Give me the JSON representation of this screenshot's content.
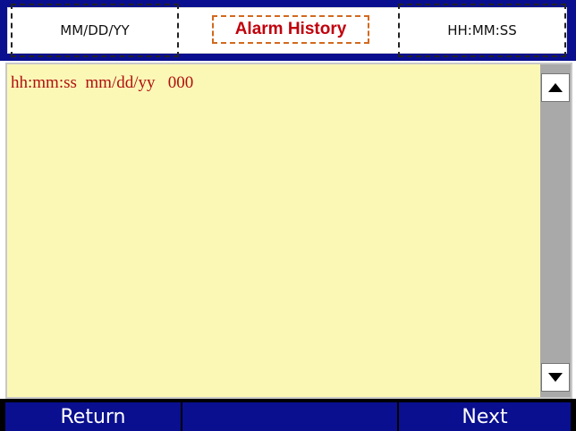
{
  "header": {
    "date_format": "MM/DD/YY",
    "title": "Alarm History",
    "time_format": "HH:MM:SS"
  },
  "alarm_list": {
    "rows": [
      "hh:mm:ss  mm/dd/yy   000"
    ]
  },
  "footer": {
    "return_label": "Return",
    "next_label": "Next"
  },
  "colors": {
    "header_bar": "#0a0f8f",
    "title_text": "#c0000c",
    "list_background": "#fbf8b6",
    "row_text": "#b01010",
    "button_background": "#0a0f8f",
    "scrollbar_track": "#a9a9a9"
  },
  "icons": {
    "scroll_up": "triangle-up-icon",
    "scroll_down": "triangle-down-icon"
  }
}
